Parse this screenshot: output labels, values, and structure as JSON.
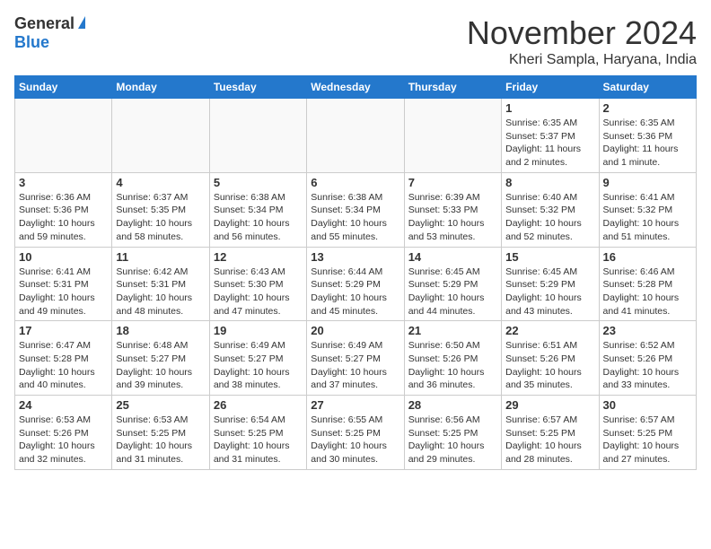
{
  "header": {
    "logo_general": "General",
    "logo_blue": "Blue",
    "month": "November 2024",
    "location": "Kheri Sampla, Haryana, India"
  },
  "days_of_week": [
    "Sunday",
    "Monday",
    "Tuesday",
    "Wednesday",
    "Thursday",
    "Friday",
    "Saturday"
  ],
  "weeks": [
    [
      {
        "day": "",
        "info": ""
      },
      {
        "day": "",
        "info": ""
      },
      {
        "day": "",
        "info": ""
      },
      {
        "day": "",
        "info": ""
      },
      {
        "day": "",
        "info": ""
      },
      {
        "day": "1",
        "info": "Sunrise: 6:35 AM\nSunset: 5:37 PM\nDaylight: 11 hours and 2 minutes."
      },
      {
        "day": "2",
        "info": "Sunrise: 6:35 AM\nSunset: 5:36 PM\nDaylight: 11 hours and 1 minute."
      }
    ],
    [
      {
        "day": "3",
        "info": "Sunrise: 6:36 AM\nSunset: 5:36 PM\nDaylight: 10 hours and 59 minutes."
      },
      {
        "day": "4",
        "info": "Sunrise: 6:37 AM\nSunset: 5:35 PM\nDaylight: 10 hours and 58 minutes."
      },
      {
        "day": "5",
        "info": "Sunrise: 6:38 AM\nSunset: 5:34 PM\nDaylight: 10 hours and 56 minutes."
      },
      {
        "day": "6",
        "info": "Sunrise: 6:38 AM\nSunset: 5:34 PM\nDaylight: 10 hours and 55 minutes."
      },
      {
        "day": "7",
        "info": "Sunrise: 6:39 AM\nSunset: 5:33 PM\nDaylight: 10 hours and 53 minutes."
      },
      {
        "day": "8",
        "info": "Sunrise: 6:40 AM\nSunset: 5:32 PM\nDaylight: 10 hours and 52 minutes."
      },
      {
        "day": "9",
        "info": "Sunrise: 6:41 AM\nSunset: 5:32 PM\nDaylight: 10 hours and 51 minutes."
      }
    ],
    [
      {
        "day": "10",
        "info": "Sunrise: 6:41 AM\nSunset: 5:31 PM\nDaylight: 10 hours and 49 minutes."
      },
      {
        "day": "11",
        "info": "Sunrise: 6:42 AM\nSunset: 5:31 PM\nDaylight: 10 hours and 48 minutes."
      },
      {
        "day": "12",
        "info": "Sunrise: 6:43 AM\nSunset: 5:30 PM\nDaylight: 10 hours and 47 minutes."
      },
      {
        "day": "13",
        "info": "Sunrise: 6:44 AM\nSunset: 5:29 PM\nDaylight: 10 hours and 45 minutes."
      },
      {
        "day": "14",
        "info": "Sunrise: 6:45 AM\nSunset: 5:29 PM\nDaylight: 10 hours and 44 minutes."
      },
      {
        "day": "15",
        "info": "Sunrise: 6:45 AM\nSunset: 5:29 PM\nDaylight: 10 hours and 43 minutes."
      },
      {
        "day": "16",
        "info": "Sunrise: 6:46 AM\nSunset: 5:28 PM\nDaylight: 10 hours and 41 minutes."
      }
    ],
    [
      {
        "day": "17",
        "info": "Sunrise: 6:47 AM\nSunset: 5:28 PM\nDaylight: 10 hours and 40 minutes."
      },
      {
        "day": "18",
        "info": "Sunrise: 6:48 AM\nSunset: 5:27 PM\nDaylight: 10 hours and 39 minutes."
      },
      {
        "day": "19",
        "info": "Sunrise: 6:49 AM\nSunset: 5:27 PM\nDaylight: 10 hours and 38 minutes."
      },
      {
        "day": "20",
        "info": "Sunrise: 6:49 AM\nSunset: 5:27 PM\nDaylight: 10 hours and 37 minutes."
      },
      {
        "day": "21",
        "info": "Sunrise: 6:50 AM\nSunset: 5:26 PM\nDaylight: 10 hours and 36 minutes."
      },
      {
        "day": "22",
        "info": "Sunrise: 6:51 AM\nSunset: 5:26 PM\nDaylight: 10 hours and 35 minutes."
      },
      {
        "day": "23",
        "info": "Sunrise: 6:52 AM\nSunset: 5:26 PM\nDaylight: 10 hours and 33 minutes."
      }
    ],
    [
      {
        "day": "24",
        "info": "Sunrise: 6:53 AM\nSunset: 5:26 PM\nDaylight: 10 hours and 32 minutes."
      },
      {
        "day": "25",
        "info": "Sunrise: 6:53 AM\nSunset: 5:25 PM\nDaylight: 10 hours and 31 minutes."
      },
      {
        "day": "26",
        "info": "Sunrise: 6:54 AM\nSunset: 5:25 PM\nDaylight: 10 hours and 31 minutes."
      },
      {
        "day": "27",
        "info": "Sunrise: 6:55 AM\nSunset: 5:25 PM\nDaylight: 10 hours and 30 minutes."
      },
      {
        "day": "28",
        "info": "Sunrise: 6:56 AM\nSunset: 5:25 PM\nDaylight: 10 hours and 29 minutes."
      },
      {
        "day": "29",
        "info": "Sunrise: 6:57 AM\nSunset: 5:25 PM\nDaylight: 10 hours and 28 minutes."
      },
      {
        "day": "30",
        "info": "Sunrise: 6:57 AM\nSunset: 5:25 PM\nDaylight: 10 hours and 27 minutes."
      }
    ]
  ]
}
